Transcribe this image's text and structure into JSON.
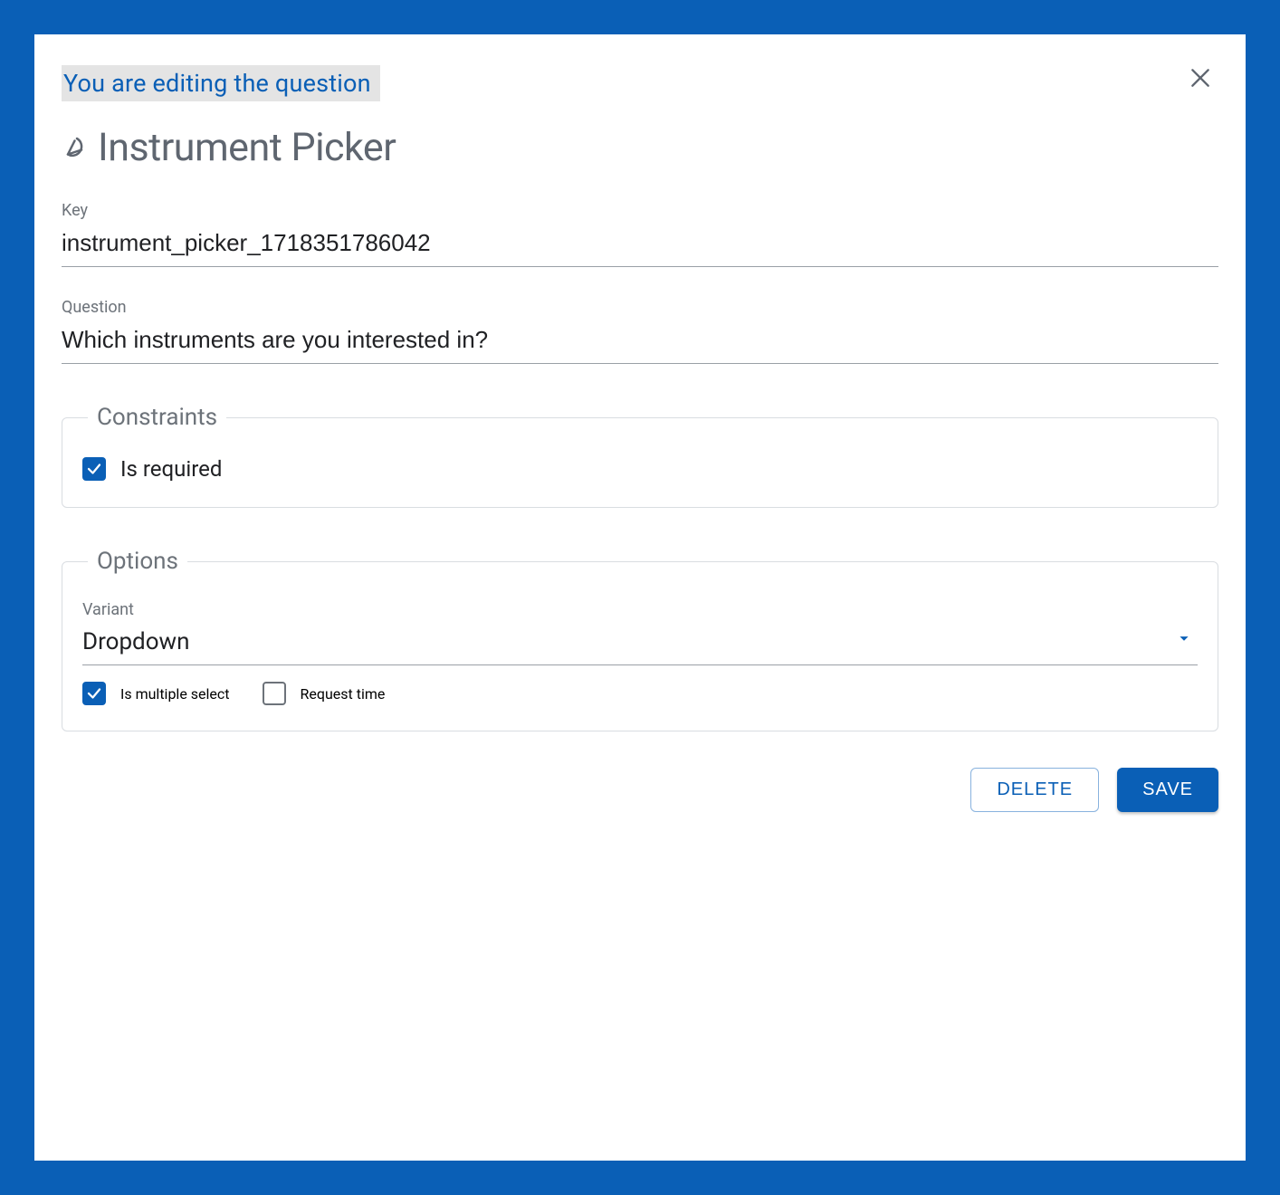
{
  "banner": "You are editing the question",
  "title": "Instrument Picker",
  "fields": {
    "key": {
      "label": "Key",
      "value": "instrument_picker_1718351786042"
    },
    "question": {
      "label": "Question",
      "value": "Which instruments are you interested in?"
    }
  },
  "constraints": {
    "legend": "Constraints",
    "is_required": {
      "label": "Is required",
      "checked": true
    }
  },
  "options": {
    "legend": "Options",
    "variant": {
      "label": "Variant",
      "value": "Dropdown"
    },
    "is_multiple": {
      "label": "Is multiple select",
      "checked": true
    },
    "request_time": {
      "label": "Request time",
      "checked": false
    }
  },
  "actions": {
    "delete": "DELETE",
    "save": "SAVE"
  }
}
